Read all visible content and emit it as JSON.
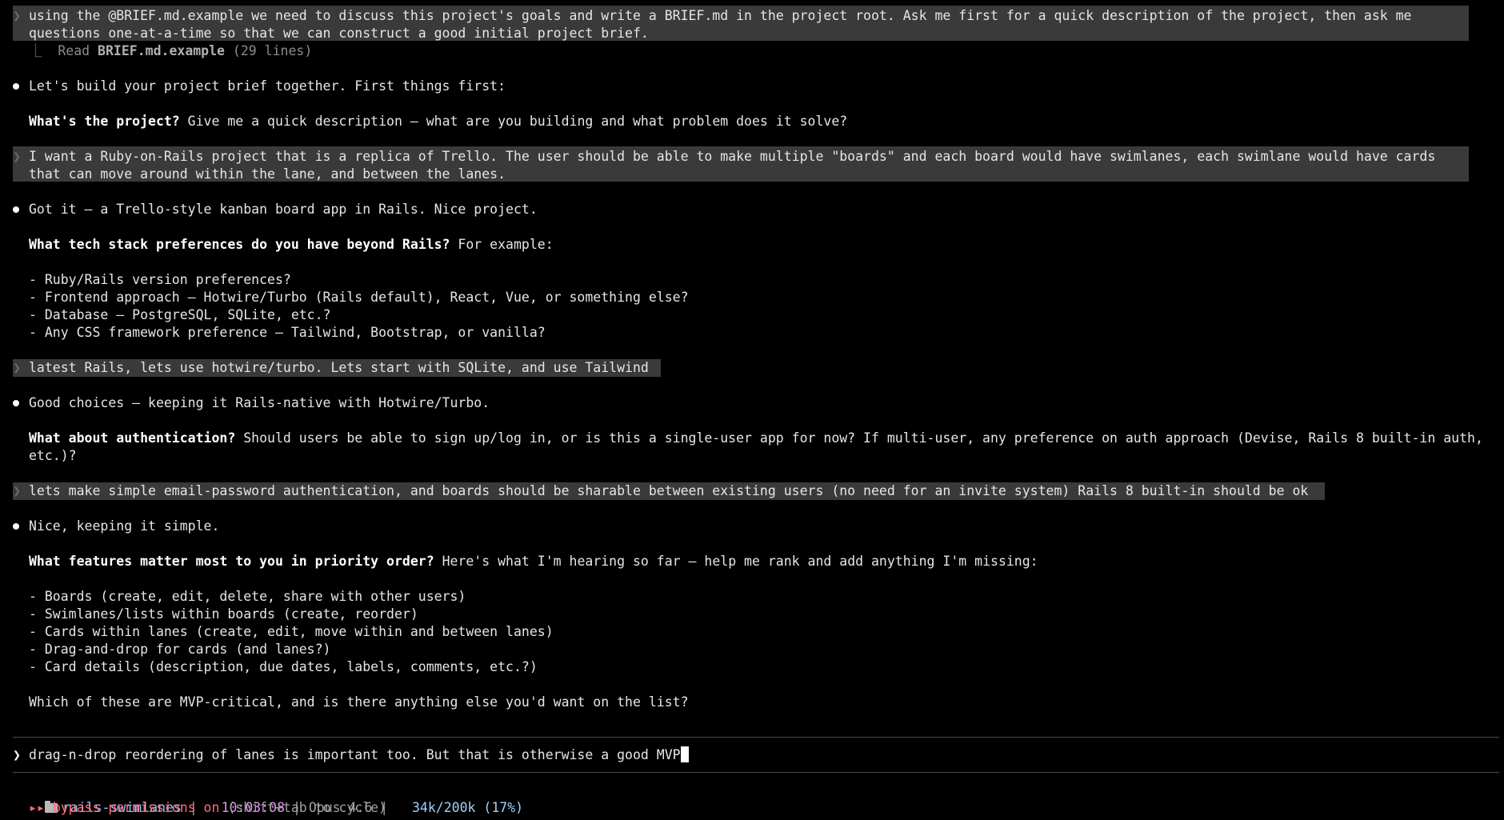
{
  "conversation": {
    "prompt1": {
      "line1": "using the @BRIEF.md.example we need to discuss this project's goals and write a BRIEF.md in the project root. Ask me first for a quick description of the project, then ask me",
      "line2": "questions one-at-a-time so that we can construct a good initial project brief."
    },
    "tool_read": {
      "prefix": "⎿  Read ",
      "file": "BRIEF.md.example",
      "suffix": " (29 lines)"
    },
    "reply1": {
      "text": "Let's build your project brief together. First things first:",
      "q_bold": "What's the project?",
      "q_rest": " Give me a quick description — what are you building and what problem does it solve?"
    },
    "prompt2": {
      "line1": "I want a Ruby-on-Rails project that is a replica of Trello. The user should be able to make multiple \"boards\" and each board would have swimlanes, each swimlane would have cards",
      "line2": "that can move around within the lane, and between the lanes."
    },
    "reply2": {
      "text": "Got it — a Trello-style kanban board app in Rails. Nice project.",
      "q_bold": "What tech stack preferences do you have beyond Rails?",
      "q_rest": " For example:",
      "items": [
        "- Ruby/Rails version preferences?",
        "- Frontend approach — Hotwire/Turbo (Rails default), React, Vue, or something else?",
        "- Database — PostgreSQL, SQLite, etc.?",
        "- Any CSS framework preference — Tailwind, Bootstrap, or vanilla?"
      ]
    },
    "prompt3": {
      "line1": "latest Rails, lets use hotwire/turbo. Lets start with SQLite, and use Tailwind"
    },
    "reply3": {
      "text": "Good choices — keeping it Rails-native with Hotwire/Turbo.",
      "q_bold": "What about authentication?",
      "q_rest": " Should users be able to sign up/log in, or is this a single-user app for now? If multi-user, any preference on auth approach (Devise, Rails 8 built-in auth,",
      "q_line2": "etc.)?"
    },
    "prompt4": {
      "line1": "lets make simple email-password authentication, and boards should be sharable between existing users (no need for an invite system) Rails 8 built-in should be ok"
    },
    "reply4": {
      "text": "Nice, keeping it simple.",
      "q_bold": "What features matter most to you in priority order?",
      "q_rest": " Here's what I'm hearing so far — help me rank and add anything I'm missing:",
      "items": [
        "- Boards (create, edit, delete, share with other users)",
        "- Swimlanes/lists within boards (create, reorder)",
        "- Cards within lanes (create, edit, move within and between lanes)",
        "- Drag-and-drop for cards (and lanes?)",
        "- Card details (description, due dates, labels, comments, etc.?)"
      ],
      "closing": "Which of these are MVP-critical, and is there anything else you'd want on the list?"
    }
  },
  "input": {
    "prompt_symbol": "❯",
    "value": "drag-n-drop reordering of lanes is important too. But that is otherwise a good MVP"
  },
  "status": {
    "icon": "folder-icon",
    "project": "rails-swimlanes",
    "sep": " |   ",
    "time": "10:03:08",
    "model": " | Opus 4.6 |   ",
    "context": "34k/200k (17%)",
    "perm_arrows": "▸▸ ",
    "perm_text": "bypass permissions on",
    "perm_hint": " (shift+tab to cycle)"
  },
  "gutter_symbol": "❯",
  "colors": {
    "background": "#000000",
    "highlight": "#3a3a3a",
    "project": "#8ec8ff",
    "time": "#e58ef2",
    "warning": "#ff6b7a"
  }
}
